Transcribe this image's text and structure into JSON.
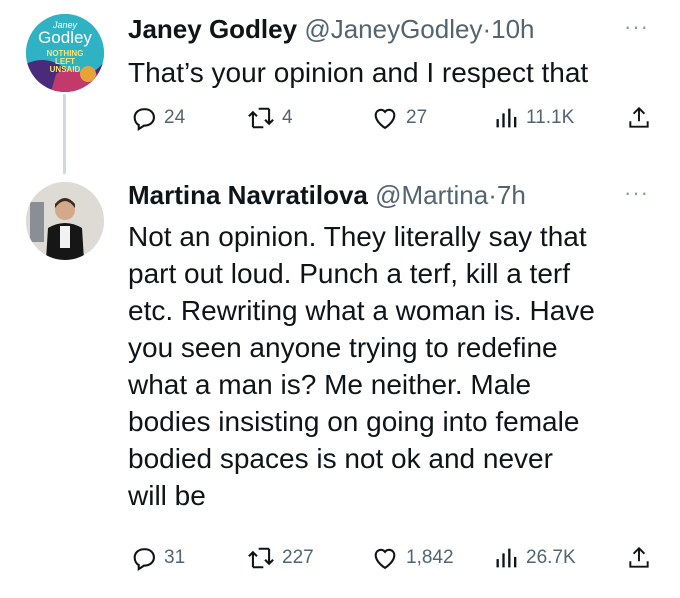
{
  "tweets": [
    {
      "name": "Janey Godley",
      "handle": "@JaneyGodley",
      "separator": "·",
      "time": "10h",
      "more": "···",
      "text": "That’s your opinion and I respect that",
      "avatar_text": {
        "top": "Janey",
        "main": "Godley",
        "line1": "NOTHING",
        "line2": "LEFT",
        "line3": "UNSAID"
      },
      "stats": {
        "replies": "24",
        "retweets": "4",
        "likes": "27",
        "views": "11.1K"
      },
      "icons": [
        "reply-icon",
        "retweet-icon",
        "like-icon",
        "views-icon",
        "share-icon"
      ]
    },
    {
      "name": "Martina Navratilova",
      "handle": "@Martina",
      "separator": "·",
      "time": "7h",
      "more": "···",
      "text_lines": [
        "Not an opinion. They literally say that",
        "part out loud. Punch a terf, kill a terf",
        "etc. Rewriting what a woman is. Have",
        "you seen anyone trying to redefine",
        "what a man is? Me neither. Male",
        "bodies insisting on going into female",
        "bodied spaces is not ok and never",
        "will be"
      ],
      "stats": {
        "replies": "31",
        "retweets": "227",
        "likes": "1,842",
        "views": "26.7K"
      },
      "icons": [
        "reply-icon",
        "retweet-icon",
        "like-icon",
        "views-icon",
        "share-icon"
      ]
    }
  ],
  "colors": {
    "text": "#0f1419",
    "muted": "#536471",
    "avatar1_bg": "#2fb3c4",
    "thread_line": "#cfd9de"
  }
}
